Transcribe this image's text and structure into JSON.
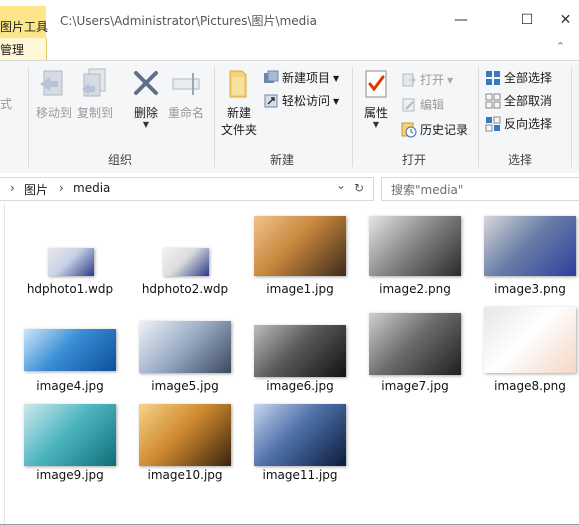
{
  "window": {
    "context_tab_title": "图片工具",
    "path_title": "C:\\Users\\Administrator\\Pictures\\图片\\media",
    "minimize": "—",
    "maximize": "☐",
    "close": "✕"
  },
  "ribbon": {
    "manage_tab": "管理",
    "collapse": "⌃",
    "partial_left": "式",
    "organize": {
      "label": "组织",
      "move_to": "移动到",
      "copy_to": "复制到",
      "delete": "删除",
      "rename": "重命名"
    },
    "new": {
      "label": "新建",
      "new_folder": "新建\n文件夹",
      "new_folder_line1": "新建",
      "new_folder_line2": "文件夹",
      "new_item": "新建项目",
      "easy_access": "轻松访问"
    },
    "open": {
      "label": "打开",
      "properties": "属性",
      "open": "打开",
      "edit": "编辑",
      "history": "历史记录"
    },
    "select": {
      "label": "选择",
      "select_all": "全部选择",
      "select_none": "全部取消",
      "invert": "反向选择"
    }
  },
  "address": {
    "arrow": "›",
    "seg1": "图片",
    "seg2": "media",
    "dropdown": "⌄",
    "refresh": "↻",
    "search_placeholder": "搜索\"media\""
  },
  "files": [
    {
      "name": "hdphoto1.wdp",
      "palette": [
        "#2a3a8c",
        "#c9d3e6",
        "#e8e8e8"
      ]
    },
    {
      "name": "hdphoto2.wdp",
      "palette": [
        "#2a3a8c",
        "#dcdcdc",
        "#f2f2f2"
      ]
    },
    {
      "name": "image1.jpg",
      "palette": [
        "#3b2a1c",
        "#c7853b",
        "#f0c48a"
      ]
    },
    {
      "name": "image2.png",
      "palette": [
        "#2a2a2a",
        "#8a8a8a",
        "#e6e6e6"
      ]
    },
    {
      "name": "image3.png",
      "palette": [
        "#2d3f9c",
        "#6b7fa8",
        "#d8d8d8"
      ]
    },
    {
      "name": "image4.jpg",
      "palette": [
        "#0d4e9a",
        "#3a8ed6",
        "#cfe6f8"
      ]
    },
    {
      "name": "image5.jpg",
      "palette": [
        "#3b4960",
        "#9fb0c8",
        "#eef2f6"
      ]
    },
    {
      "name": "image6.jpg",
      "palette": [
        "#111111",
        "#5a5a5a",
        "#bdbdbd"
      ]
    },
    {
      "name": "image7.jpg",
      "palette": [
        "#1f1f1f",
        "#6f6f6f",
        "#d0d0d0"
      ]
    },
    {
      "name": "image8.png",
      "palette": [
        "#f4d7c6",
        "#ffffff",
        "#e6e6e6"
      ]
    },
    {
      "name": "image9.jpg",
      "palette": [
        "#0f6e7a",
        "#4fb6c1",
        "#cfe9ec"
      ]
    },
    {
      "name": "image10.jpg",
      "palette": [
        "#3a2410",
        "#d08a2e",
        "#f7d28a"
      ]
    },
    {
      "name": "image11.jpg",
      "palette": [
        "#0d1b3a",
        "#4d6fa8",
        "#c7d6ee"
      ]
    }
  ],
  "colors": {
    "accent": "#1a73c9",
    "context_tab": "#fde68a"
  }
}
